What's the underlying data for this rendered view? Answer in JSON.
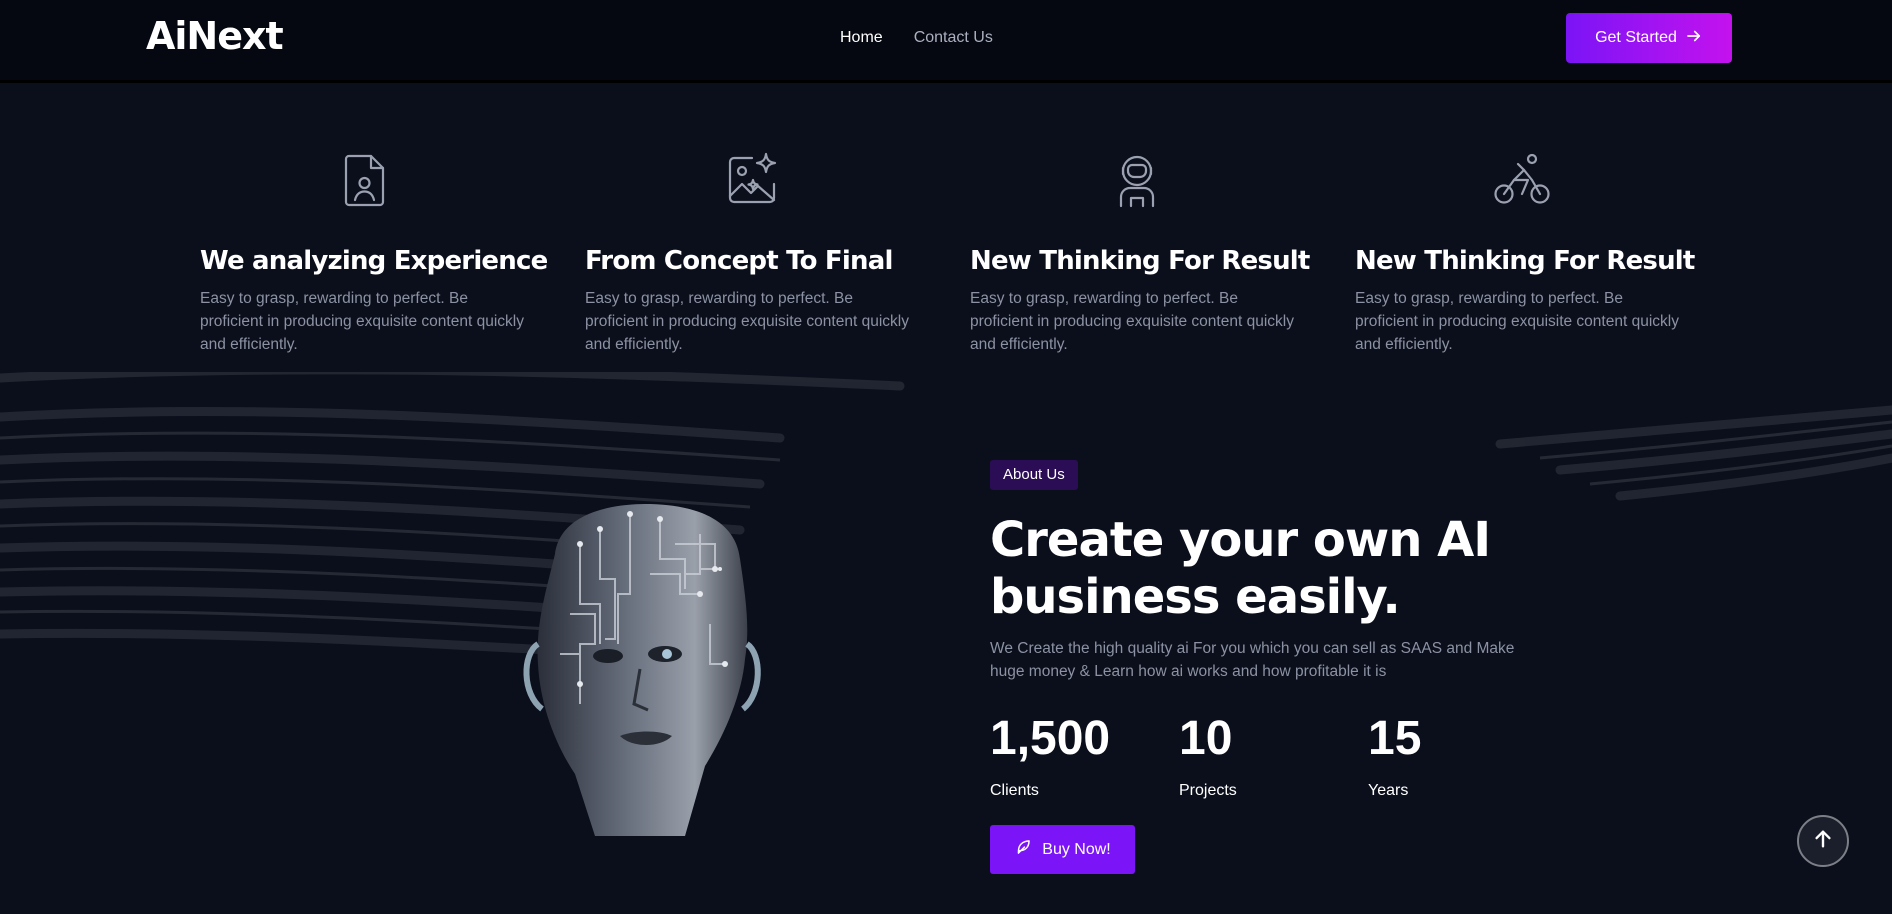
{
  "header": {
    "logo": "AiNext",
    "nav": [
      {
        "label": "Home",
        "active": true
      },
      {
        "label": "Contact Us",
        "active": false
      }
    ],
    "cta_label": "Get Started",
    "cta_icon": "arrow-right-icon"
  },
  "features": [
    {
      "icon": "document-user-icon",
      "title": "We analyzing Experience",
      "text": "Easy to grasp, rewarding to perfect. Be proficient in producing exquisite content quickly and efficiently."
    },
    {
      "icon": "image-sparkle-icon",
      "title": "From Concept To Final",
      "text": "Easy to grasp, rewarding to perfect. Be proficient in producing exquisite content quickly and efficiently."
    },
    {
      "icon": "astronaut-icon",
      "title": "New Thinking For Result",
      "text": "Easy to grasp, rewarding to perfect. Be proficient in producing exquisite content quickly and efficiently."
    },
    {
      "icon": "cyclist-icon",
      "title": "New Thinking For Result",
      "text": "Easy to grasp, rewarding to perfect. Be proficient in producing exquisite content quickly and efficiently."
    }
  ],
  "about": {
    "badge": "About Us",
    "title": "Create your own AI business easily.",
    "description": "We Create the high quality ai For you which you can sell as SAAS and Make huge money & Learn how ai works and how profitable it is",
    "stats": [
      {
        "value": "1,500",
        "label": "Clients"
      },
      {
        "value": "10",
        "label": "Projects"
      },
      {
        "value": "15",
        "label": "Years"
      }
    ],
    "buy_label": "Buy Now!",
    "buy_icon": "feather-icon"
  },
  "scroll_top_icon": "arrow-up-icon",
  "colors": {
    "background": "#0b0f1c",
    "header_bg": "#050810",
    "accent": "#7b14f6",
    "accent_gradient_end": "#c412ee",
    "badge_bg": "#2a0d55",
    "muted_text": "#8c92a3"
  }
}
